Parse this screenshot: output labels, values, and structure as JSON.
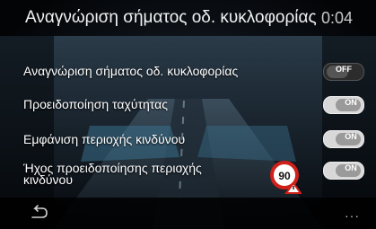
{
  "header": {
    "title": "Αναγνώριση σήματος οδ. κυκλοφορίας",
    "clock": "0:04"
  },
  "settings": [
    {
      "label": "Αναγνώριση σήματος οδ. κυκλοφορίας",
      "toggle_text": "OFF",
      "state": "off"
    },
    {
      "label": "Προειδοποίηση ταχύτητας",
      "toggle_text": "ON",
      "state": "on"
    },
    {
      "label": "Εμφάνιση περιοχής κινδύνου",
      "toggle_text": "ON",
      "state": "on"
    },
    {
      "label": "Ήχος προειδοποίησης περιοχής κινδύνου",
      "label_line1": "Ήχος προειδοποίησης περιοχής",
      "label_line2": "κινδύνου",
      "toggle_text": "ON",
      "state": "on"
    }
  ],
  "sign": {
    "speed": "90"
  },
  "footer": {
    "back_icon": "back-arrow-icon",
    "more_icon": "more-icon",
    "more_text": "···"
  }
}
